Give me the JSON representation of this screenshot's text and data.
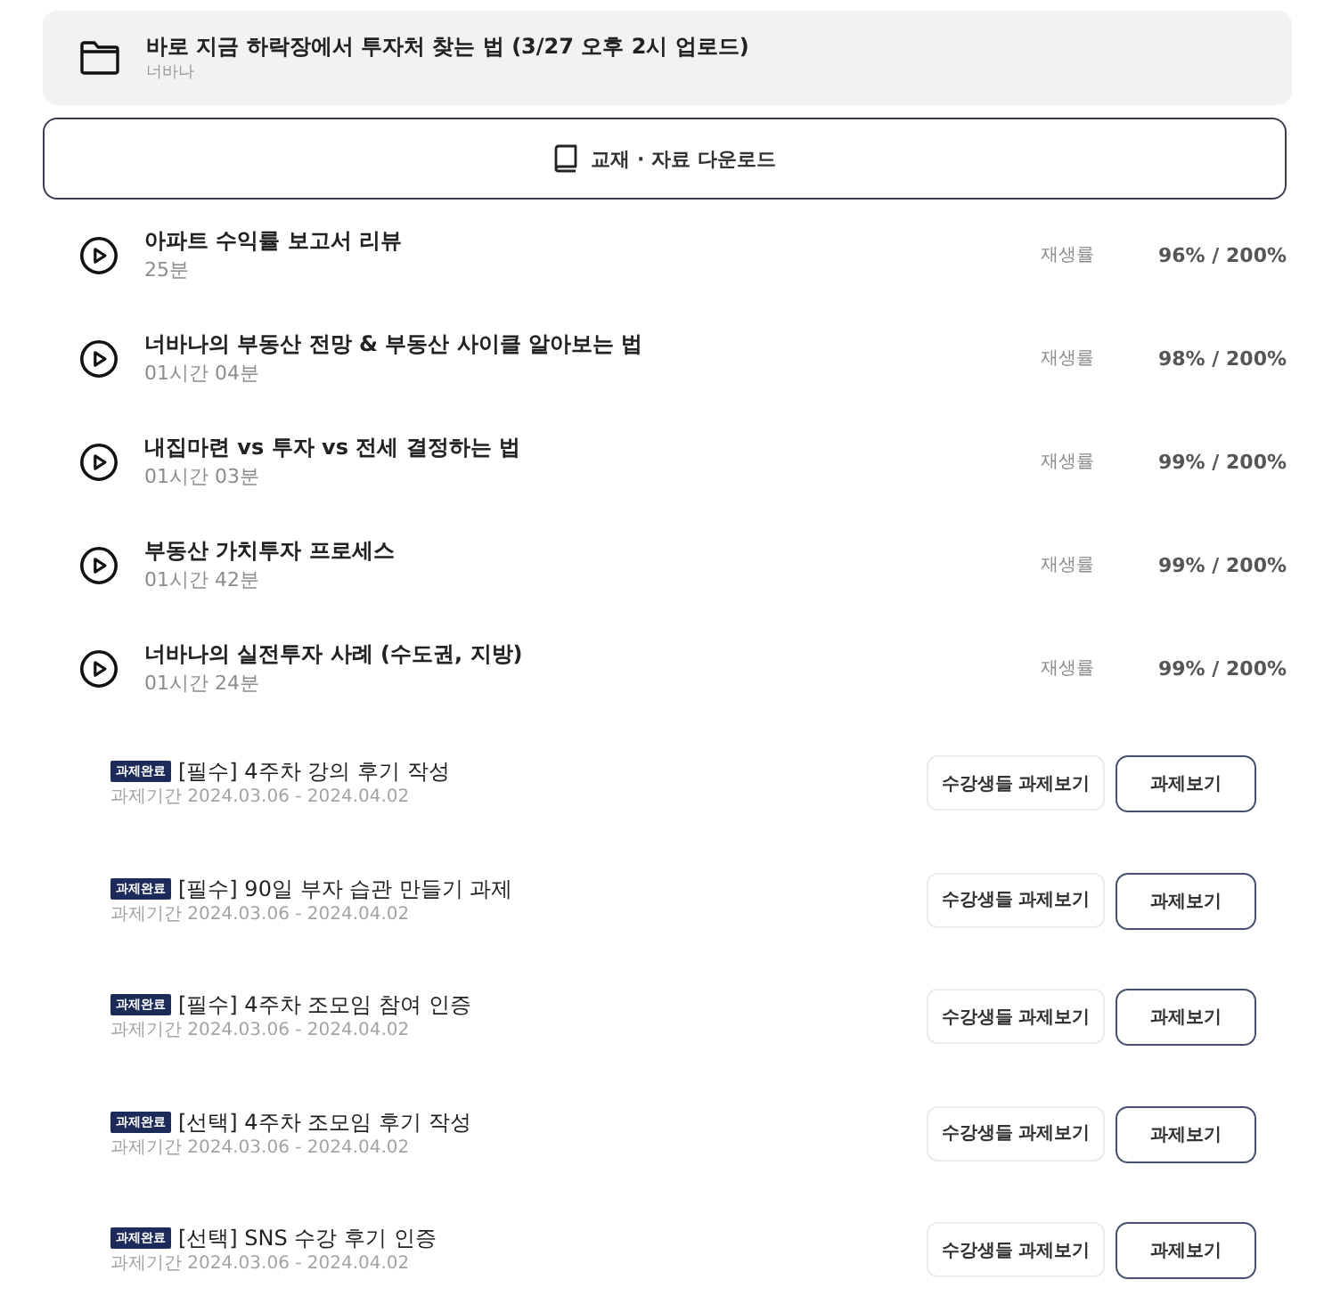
{
  "folder": {
    "title": "바로 지금 하락장에서 투자처 찾는 법 (3/27 오후 2시 업로드)",
    "author": "너바나"
  },
  "download_button": {
    "label": "교재 · 자료 다운로드"
  },
  "lectures": [
    {
      "title": "아파트 수익률 보고서 리뷰",
      "duration": "25분",
      "rate_label": "재생률",
      "rate": "96% / 200%"
    },
    {
      "title": "너바나의 부동산 전망 & 부동산 사이클 알아보는 법",
      "duration": "01시간 04분",
      "rate_label": "재생률",
      "rate": "98% / 200%"
    },
    {
      "title": "내집마련 vs 투자 vs 전세 결정하는 법",
      "duration": "01시간 03분",
      "rate_label": "재생률",
      "rate": "99% / 200%"
    },
    {
      "title": "부동산 가치투자 프로세스",
      "duration": "01시간 42분",
      "rate_label": "재생률",
      "rate": "99% / 200%"
    },
    {
      "title": "너바나의 실전투자 사례 (수도권, 지방)",
      "duration": "01시간 24분",
      "rate_label": "재생률",
      "rate": "99% / 200%"
    }
  ],
  "assignments": [
    {
      "status": "과제완료",
      "title": "[필수] 4주차 강의 후기 작성",
      "period": "과제기간 2024.03.06 - 2024.04.02",
      "peers_button": "수강생들 과제보기",
      "view_button": "과제보기"
    },
    {
      "status": "과제완료",
      "title": "[필수] 90일 부자 습관 만들기 과제",
      "period": "과제기간 2024.03.06 - 2024.04.02",
      "peers_button": "수강생들 과제보기",
      "view_button": "과제보기"
    },
    {
      "status": "과제완료",
      "title": "[필수] 4주차 조모임 참여 인증",
      "period": "과제기간 2024.03.06 - 2024.04.02",
      "peers_button": "수강생들 과제보기",
      "view_button": "과제보기"
    },
    {
      "status": "과제완료",
      "title": "[선택] 4주차 조모임 후기 작성",
      "period": "과제기간 2024.03.06 - 2024.04.02",
      "peers_button": "수강생들 과제보기",
      "view_button": "과제보기"
    },
    {
      "status": "과제완료",
      "title": "[선택] SNS 수강 후기 인증",
      "period": "과제기간 2024.03.06 - 2024.04.02",
      "peers_button": "수강생들 과제보기",
      "view_button": "과제보기"
    }
  ]
}
